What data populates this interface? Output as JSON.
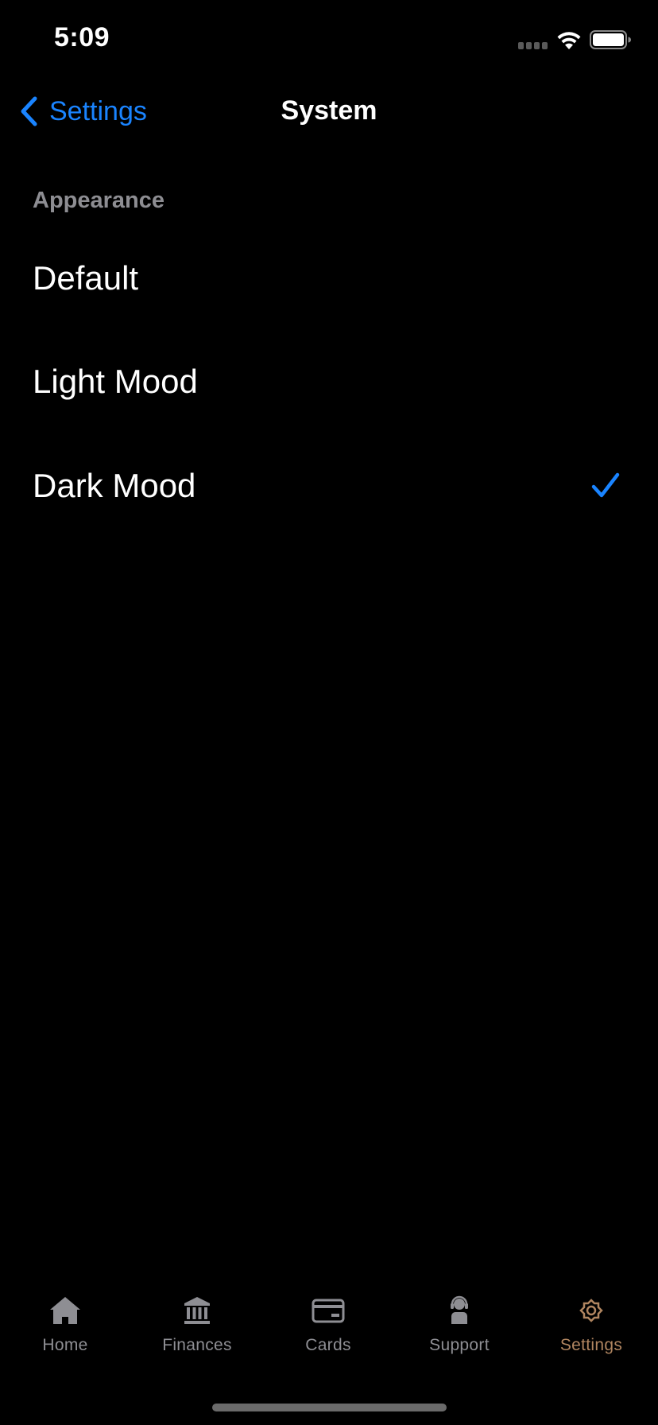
{
  "status_bar": {
    "time": "5:09"
  },
  "nav": {
    "back_label": "Settings",
    "title": "System"
  },
  "section": {
    "header": "Appearance"
  },
  "options": [
    {
      "label": "Default",
      "selected": false
    },
    {
      "label": "Light Mood",
      "selected": false
    },
    {
      "label": "Dark Mood",
      "selected": true
    }
  ],
  "tab_bar": {
    "items": [
      {
        "label": "Home",
        "icon": "house-icon",
        "active": false
      },
      {
        "label": "Finances",
        "icon": "bank-icon",
        "active": false
      },
      {
        "label": "Cards",
        "icon": "credit-card-icon",
        "active": false
      },
      {
        "label": "Support",
        "icon": "support-agent-icon",
        "active": false
      },
      {
        "label": "Settings",
        "icon": "gear-icon",
        "active": true
      }
    ]
  },
  "colors": {
    "background": "#000000",
    "accent_blue": "#1a84ff",
    "section_header": "#8d8d92",
    "tab_inactive": "#8e8e93",
    "tab_active": "#b08560"
  }
}
